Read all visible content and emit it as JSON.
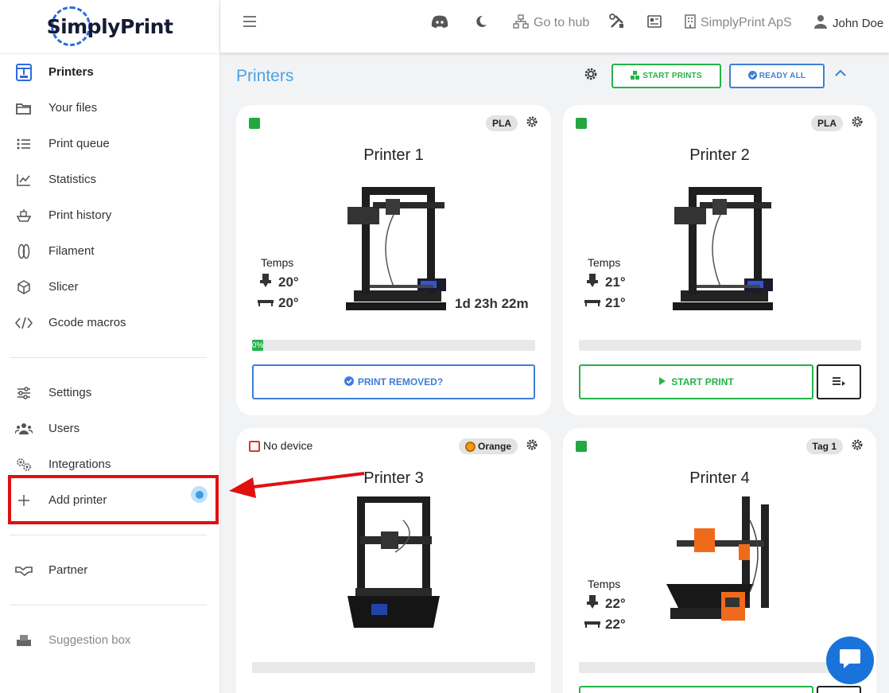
{
  "app": {
    "logo_text": "SimplyPrint"
  },
  "sidebar": {
    "items": [
      {
        "label": "Printers",
        "icon": "printer-icon"
      },
      {
        "label": "Your files",
        "icon": "folder-icon"
      },
      {
        "label": "Print queue",
        "icon": "list-icon"
      },
      {
        "label": "Statistics",
        "icon": "chart-icon"
      },
      {
        "label": "Print history",
        "icon": "boat-icon"
      },
      {
        "label": "Filament",
        "icon": "filament-icon"
      },
      {
        "label": "Slicer",
        "icon": "cube-icon"
      },
      {
        "label": "Gcode macros",
        "icon": "code-icon"
      },
      {
        "label": "Settings",
        "icon": "sliders-icon"
      },
      {
        "label": "Users",
        "icon": "users-icon"
      },
      {
        "label": "Integrations",
        "icon": "gears-icon"
      },
      {
        "label": "Add printer",
        "icon": "plus-icon"
      },
      {
        "label": "Partner",
        "icon": "handshake-icon"
      },
      {
        "label": "Suggestion box",
        "icon": "inbox-icon"
      }
    ]
  },
  "topbar": {
    "hub_label": "Go to hub",
    "company_label": "SimplyPrint ApS",
    "user_label": "John Doe"
  },
  "main": {
    "title": "Printers",
    "start_prints_label": "START PRINTS",
    "ready_all_label": "READY ALL"
  },
  "printers": [
    {
      "name": "Printer 1",
      "tag": "PLA",
      "temps_label": "Temps",
      "nozzle": "20°",
      "bed": "20°",
      "eta": "1d 23h 22m",
      "progress": "0%",
      "progress_value": 0.04,
      "button": "PRINT REMOVED?"
    },
    {
      "name": "Printer 2",
      "tag": "PLA",
      "temps_label": "Temps",
      "nozzle": "21°",
      "bed": "21°",
      "button": "START PRINT"
    },
    {
      "name": "Printer 3",
      "tag": "Orange",
      "status": "No device"
    },
    {
      "name": "Printer 4",
      "tag": "Tag 1",
      "temps_label": "Temps",
      "nozzle": "22°",
      "bed": "22°"
    }
  ],
  "colors": {
    "accent_blue": "#4aa3df",
    "green": "#23b34a",
    "highlight_red": "#e01010"
  }
}
